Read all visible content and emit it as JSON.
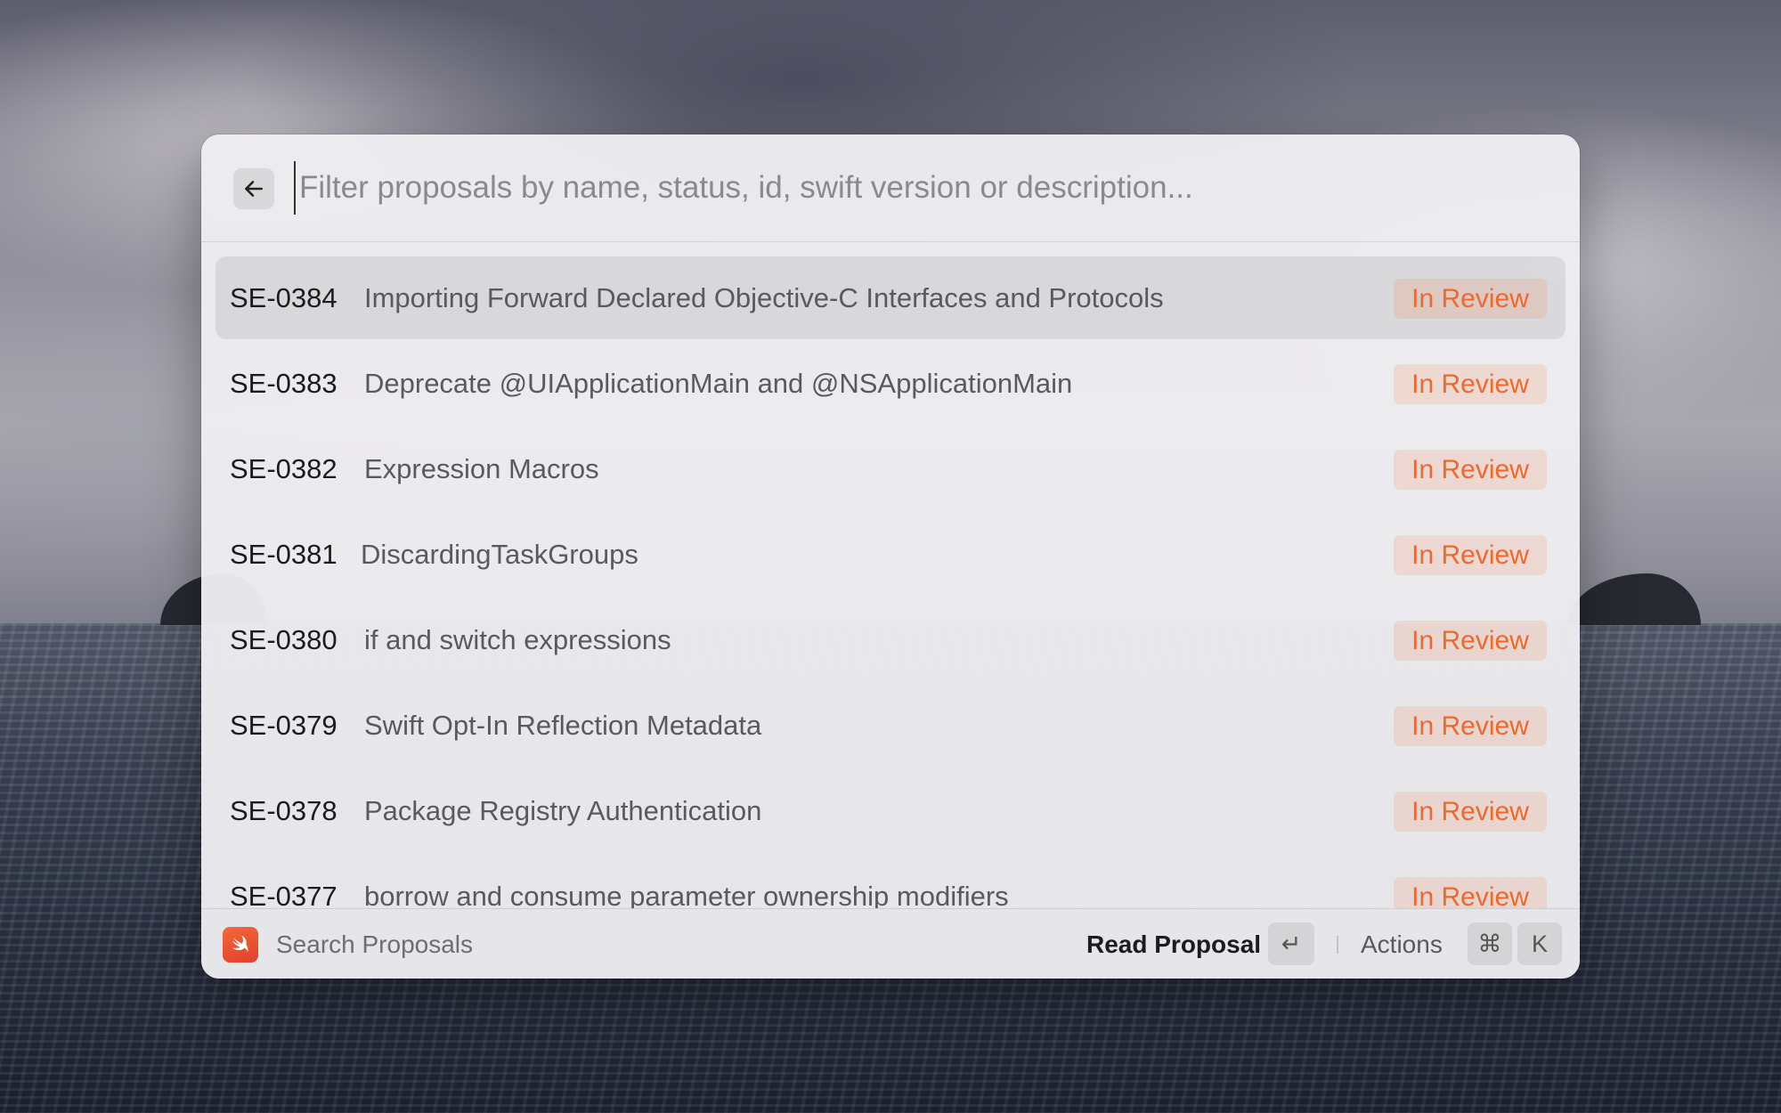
{
  "search": {
    "placeholder": "Filter proposals by name, status, id, swift version or description..."
  },
  "proposals": [
    {
      "id": "SE-0384",
      "title": "Importing Forward Declared Objective-C Interfaces and Protocols",
      "status": "In Review",
      "selected": true
    },
    {
      "id": "SE-0383",
      "title": "Deprecate @UIApplicationMain and @NSApplicationMain",
      "status": "In Review"
    },
    {
      "id": "SE-0382",
      "title": "Expression Macros",
      "status": "In Review"
    },
    {
      "id": "SE-0381",
      "title": "DiscardingTaskGroups",
      "status": "In Review"
    },
    {
      "id": "SE-0380",
      "title": "if and switch expressions",
      "status": "In Review"
    },
    {
      "id": "SE-0379",
      "title": "Swift Opt-In Reflection Metadata",
      "status": "In Review"
    },
    {
      "id": "SE-0378",
      "title": "Package Registry Authentication",
      "status": "In Review"
    },
    {
      "id": "SE-0377",
      "title": "borrow and consume parameter ownership modifiers",
      "status": "In Review"
    }
  ],
  "footer": {
    "title": "Search Proposals",
    "primary_action": "Read Proposal",
    "enter_key": "↵",
    "actions_label": "Actions",
    "cmd_key": "⌘",
    "k_key": "K"
  },
  "colors": {
    "status_text": "#ea6a2f",
    "app_icon": "#f05138"
  },
  "icons": {
    "back": "arrow-left-icon",
    "app": "swift-icon"
  }
}
